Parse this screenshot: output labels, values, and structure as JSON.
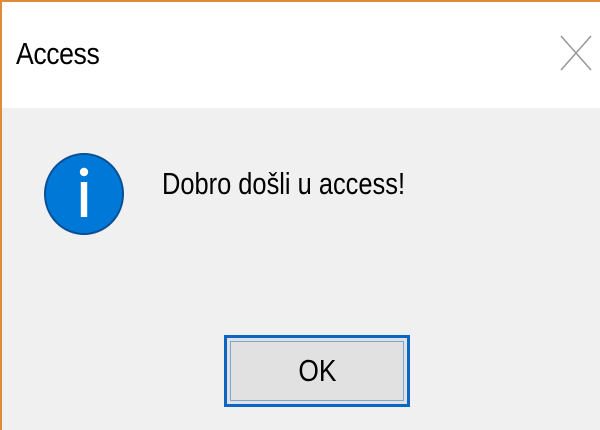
{
  "dialog": {
    "title": "Access",
    "message": "Dobro došli u access!",
    "ok_label": "OK",
    "icon": "information-icon",
    "close_icon": "close-icon"
  },
  "colors": {
    "content_background": "#f0f0f0",
    "titlebar_background": "#ffffff",
    "window_border": "#e08a3c",
    "info_icon_fill": "#0078d7",
    "button_focus_border": "#0a66c2",
    "button_background": "#e1e1e1"
  }
}
